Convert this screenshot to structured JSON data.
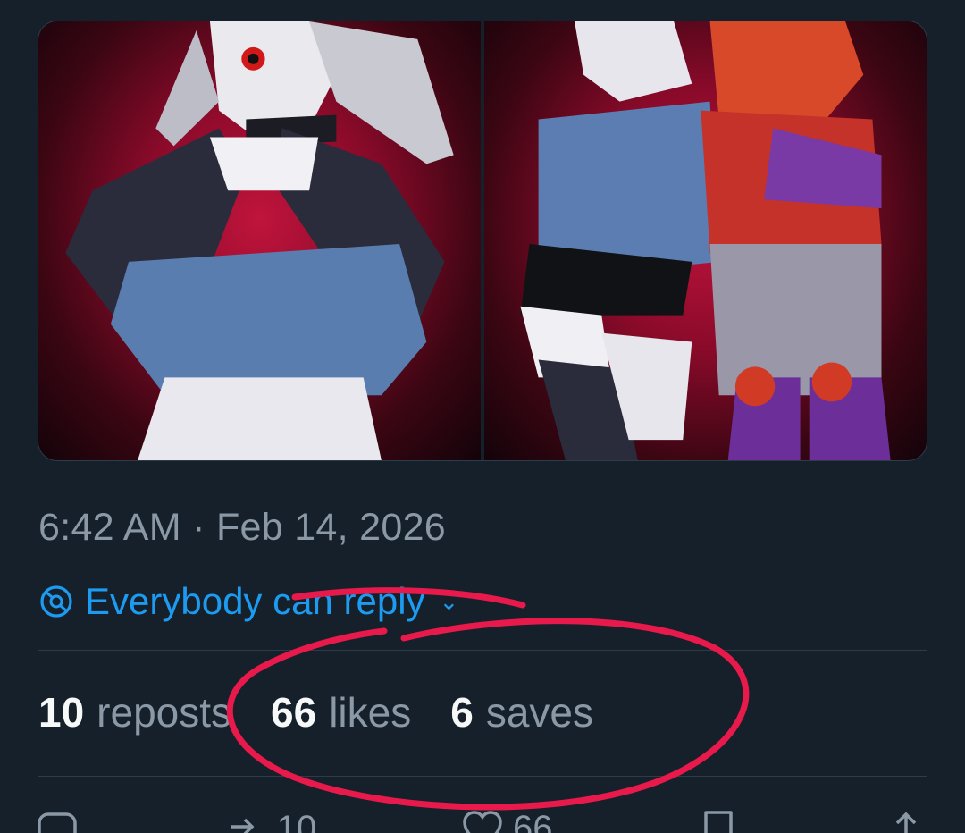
{
  "post": {
    "timestamp": "6:42 AM · Feb 14, 2026",
    "reply_setting": "Everybody can reply",
    "reply_chevron": "⌄"
  },
  "media": [
    {
      "kind": "image",
      "description_icon": "artwork-image-1"
    },
    {
      "kind": "image",
      "description_icon": "artwork-image-2"
    }
  ],
  "stats": {
    "reposts": {
      "count": "10",
      "label": "reposts"
    },
    "likes": {
      "count": "66",
      "label": "likes"
    },
    "saves": {
      "count": "6",
      "label": "saves"
    }
  },
  "actions": {
    "reply": {
      "icon": "reply-icon",
      "count": ""
    },
    "repost": {
      "icon": "repost-icon",
      "count": "10"
    },
    "like": {
      "icon": "like-icon",
      "count": "66"
    },
    "bookmark": {
      "icon": "bookmark-icon",
      "count": ""
    },
    "share": {
      "icon": "share-icon",
      "count": ""
    }
  },
  "colors": {
    "background": "#15202b",
    "accent": "#1d9bf0",
    "muted_text": "#8b98a5",
    "annotation": "#e8194b"
  }
}
